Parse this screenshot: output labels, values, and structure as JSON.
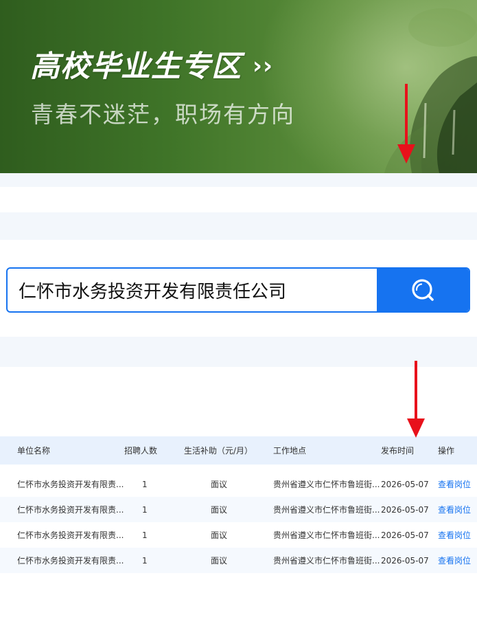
{
  "banner": {
    "title": "高校毕业生专区",
    "title_arrow": "››",
    "subtitle": "青春不迷茫，职场有方向"
  },
  "search": {
    "value": "仁怀市水务投资开发有限责任公司",
    "icon": "search-icon",
    "accent_color": "#1673f0"
  },
  "table": {
    "headers": {
      "company": "单位名称",
      "count": "招聘人数",
      "subsidy": "生活补助（元/月）",
      "location": "工作地点",
      "date": "发布时间",
      "action": "操作"
    },
    "rows": [
      {
        "company": "仁怀市水务投资开发有限责...",
        "count": "1",
        "subsidy": "面议",
        "location": "贵州省遵义市仁怀市鲁班街...",
        "date": "2026-05-07",
        "action": "查看岗位"
      },
      {
        "company": "仁怀市水务投资开发有限责...",
        "count": "1",
        "subsidy": "面议",
        "location": "贵州省遵义市仁怀市鲁班街...",
        "date": "2026-05-07",
        "action": "查看岗位"
      },
      {
        "company": "仁怀市水务投资开发有限责...",
        "count": "1",
        "subsidy": "面议",
        "location": "贵州省遵义市仁怀市鲁班街...",
        "date": "2026-05-07",
        "action": "查看岗位"
      },
      {
        "company": "仁怀市水务投资开发有限责...",
        "count": "1",
        "subsidy": "面议",
        "location": "贵州省遵义市仁怀市鲁班街...",
        "date": "2026-05-07",
        "action": "查看岗位"
      }
    ]
  },
  "annotations": {
    "arrow_color": "#e8111b"
  }
}
